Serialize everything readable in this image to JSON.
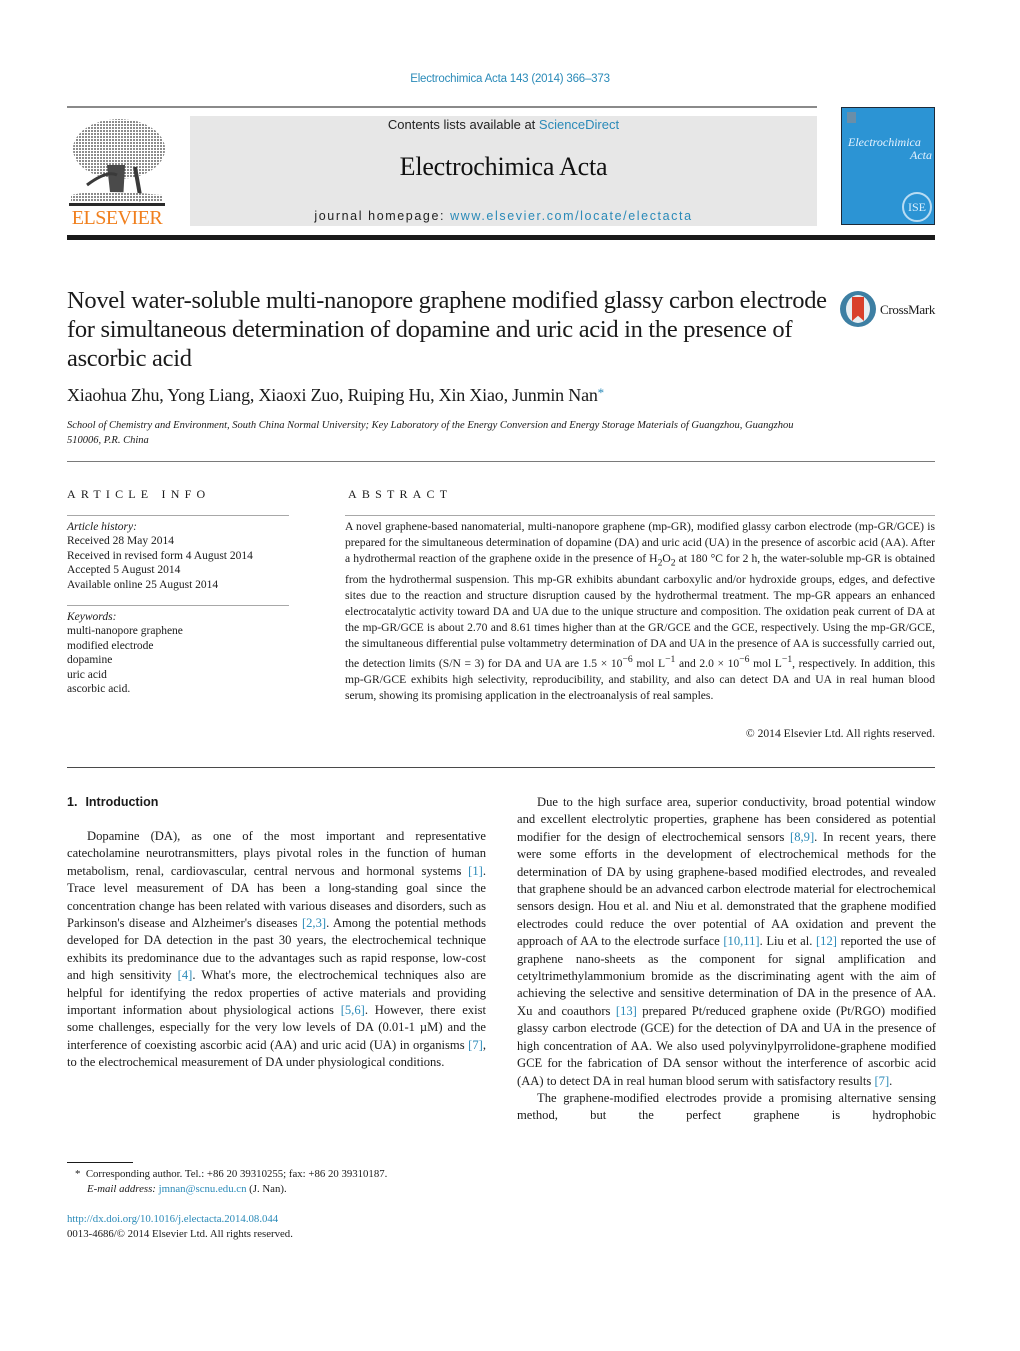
{
  "header": {
    "journal_reference": "Electrochimica Acta 143 (2014) 366–373",
    "contents_prefix": "Contents lists available at ",
    "contents_link": "ScienceDirect",
    "journal_name": "Electrochimica Acta",
    "homepage_prefix": "journal homepage: ",
    "homepage_link": "www.elsevier.com/locate/electacta",
    "publisher_logo_text": "ELSEVIER",
    "cover_title_line1": "Electrochimica",
    "cover_title_line2": "Acta",
    "cover_badge": "ISE",
    "colors": {
      "link": "#2a8ab8",
      "publisher_orange": "#f07f1d",
      "cover_blue": "#2c94d4",
      "banner_gray": "#e7e7e7"
    }
  },
  "article": {
    "title": "Novel water-soluble multi-nanopore graphene modified glassy carbon electrode for simultaneous determination of dopamine and uric acid in the presence of ascorbic acid",
    "crossmark_label": "CrossMark",
    "authors": "Xiaohua Zhu, Yong Liang, Xiaoxi Zuo, Ruiping Hu, Xin Xiao, Junmin Nan",
    "corresponding_marker": "*",
    "affiliation": "School of Chemistry and Environment, South China Normal University; Key Laboratory of the Energy Conversion and Energy Storage Materials of Guangzhou, Guangzhou 510006, P.R. China"
  },
  "article_info": {
    "section_label": "ARTICLE INFO",
    "history_heading": "Article history:",
    "history": [
      "Received 28 May 2014",
      "Received in revised form 4 August 2014",
      "Accepted 5 August 2014",
      "Available online 25 August 2014"
    ],
    "keywords_heading": "Keywords:",
    "keywords": [
      "multi-nanopore graphene",
      "modified electrode",
      "dopamine",
      "uric acid",
      "ascorbic acid."
    ]
  },
  "abstract": {
    "section_label": "ABSTRACT",
    "part1": "A novel graphene-based nanomaterial, multi-nanopore graphene (mp-GR), modified glassy carbon electrode (mp-GR/GCE) is prepared for the simultaneous determination of dopamine (DA) and uric acid (UA) in the presence of ascorbic acid (AA). After a hydrothermal reaction of the graphene oxide in the presence of H",
    "sub1": "2",
    "mid1": "O",
    "sub2": "2",
    "part2": " at 180 °C for 2 h, the water-soluble mp-GR is obtained from the hydrothermal suspension. This mp-GR exhibits abundant carboxylic and/or hydroxide groups, edges, and defective sites due to the reaction and structure disruption caused by the hydrothermal treatment. The mp-GR appears an enhanced electrocatalytic activity toward DA and UA due to the unique structure and composition. The oxidation peak current of DA at the mp-GR/GCE is about 2.70 and 8.61 times higher than at the GR/GCE and the GCE, respectively. Using the mp-GR/GCE, the simultaneous differential pulse voltammetry determination of DA and UA in the presence of AA is successfully carried out, the detection limits (S/N = 3) for DA and UA are 1.5 × 10",
    "sup1": "−6",
    "part3": " mol L",
    "sup2": "−1",
    "part4": " and 2.0 × 10",
    "sup3": "−6",
    "part5": " mol L",
    "sup4": "−1",
    "part6": ", respectively. In addition, this mp-GR/GCE exhibits high selectivity, reproducibility, and stability, and also can detect DA and UA in real human blood serum, showing its promising application in the electroanalysis of real samples.",
    "copyright": "© 2014 Elsevier Ltd. All rights reserved."
  },
  "introduction": {
    "number": "1.",
    "heading": "Introduction",
    "p1": [
      {
        "t": "Dopamine (DA), as one of the most important and representative catecholamine neurotransmitters, plays pivotal roles in the function of human metabolism, renal, cardiovascular, central nervous and hormonal systems "
      },
      {
        "ref": "[1]"
      },
      {
        "t": ". Trace level measurement of DA has been a long-standing goal since the concentration change has been related with various diseases and disorders, such as Parkinson's disease and Alzheimer's diseases "
      },
      {
        "ref": "[2,3]"
      },
      {
        "t": ". Among the potential methods developed for DA detection in the past 30 years, the electrochemical technique exhibits its predominance due to the advantages such as rapid response, low-cost and high sensitivity "
      },
      {
        "ref": "[4]"
      },
      {
        "t": ". What's more, the electrochemical techniques also are helpful for identifying the redox properties of active materials and providing important information about physiological actions "
      },
      {
        "ref": "[5,6]"
      },
      {
        "t": ". However, there exist some challenges, especially for the very low levels of DA (0.01-1 µM) and the interference of coexisting ascorbic acid (AA) and uric acid (UA) in organisms "
      },
      {
        "ref": "[7]"
      },
      {
        "t": ", to the electrochemical measurement of DA under physiological conditions."
      }
    ],
    "p2": [
      {
        "t": "Due to the high surface area, superior conductivity, broad potential window and excellent electrolytic properties, graphene has been considered as potential modifier for the design of electrochemical sensors "
      },
      {
        "ref": "[8,9]"
      },
      {
        "t": ". In recent years, there were some efforts in the development of electrochemical methods for the determination of DA by using graphene-based modified electrodes, and revealed that graphene should be an advanced carbon electrode material for electrochemical sensors design. Hou et al. and Niu et al. demonstrated that the graphene modified electrodes could reduce the over potential of AA oxidation and prevent the approach of AA to the electrode surface "
      },
      {
        "ref": "[10,11]"
      },
      {
        "t": ". Liu et al. "
      },
      {
        "ref": "[12]"
      },
      {
        "t": " reported the use of graphene nano-sheets as the component for signal amplification and cetyltrimethylammonium bromide as the discriminating agent with the aim of achieving the selective and sensitive determination of DA in the presence of AA. Xu and coauthors "
      },
      {
        "ref": "[13]"
      },
      {
        "t": " prepared Pt/reduced graphene oxide (Pt/RGO) modified glassy carbon electrode (GCE) for the detection of DA and UA in the presence of high concentration of AA. We also used polyvinylpyrrolidone-graphene modified GCE for the fabrication of DA sensor without the interference of ascorbic acid (AA) to detect DA in real human blood serum with satisfactory results "
      },
      {
        "ref": "[7]"
      },
      {
        "t": "."
      }
    ],
    "p3": [
      {
        "t": "The graphene-modified electrodes provide a promising alternative sensing method, but the perfect graphene is hydrophobic"
      }
    ]
  },
  "footnote": {
    "marker": "*",
    "corresponding": "Corresponding author. Tel.: +86 20 39310255; fax: +86 20 39310187.",
    "email_label": "E-mail address: ",
    "email": "jmnan@scnu.edu.cn",
    "email_suffix": " (J. Nan).",
    "doi": "http://dx.doi.org/10.1016/j.electacta.2014.08.044",
    "issn_line": "0013-4686/© 2014 Elsevier Ltd. All rights reserved."
  }
}
